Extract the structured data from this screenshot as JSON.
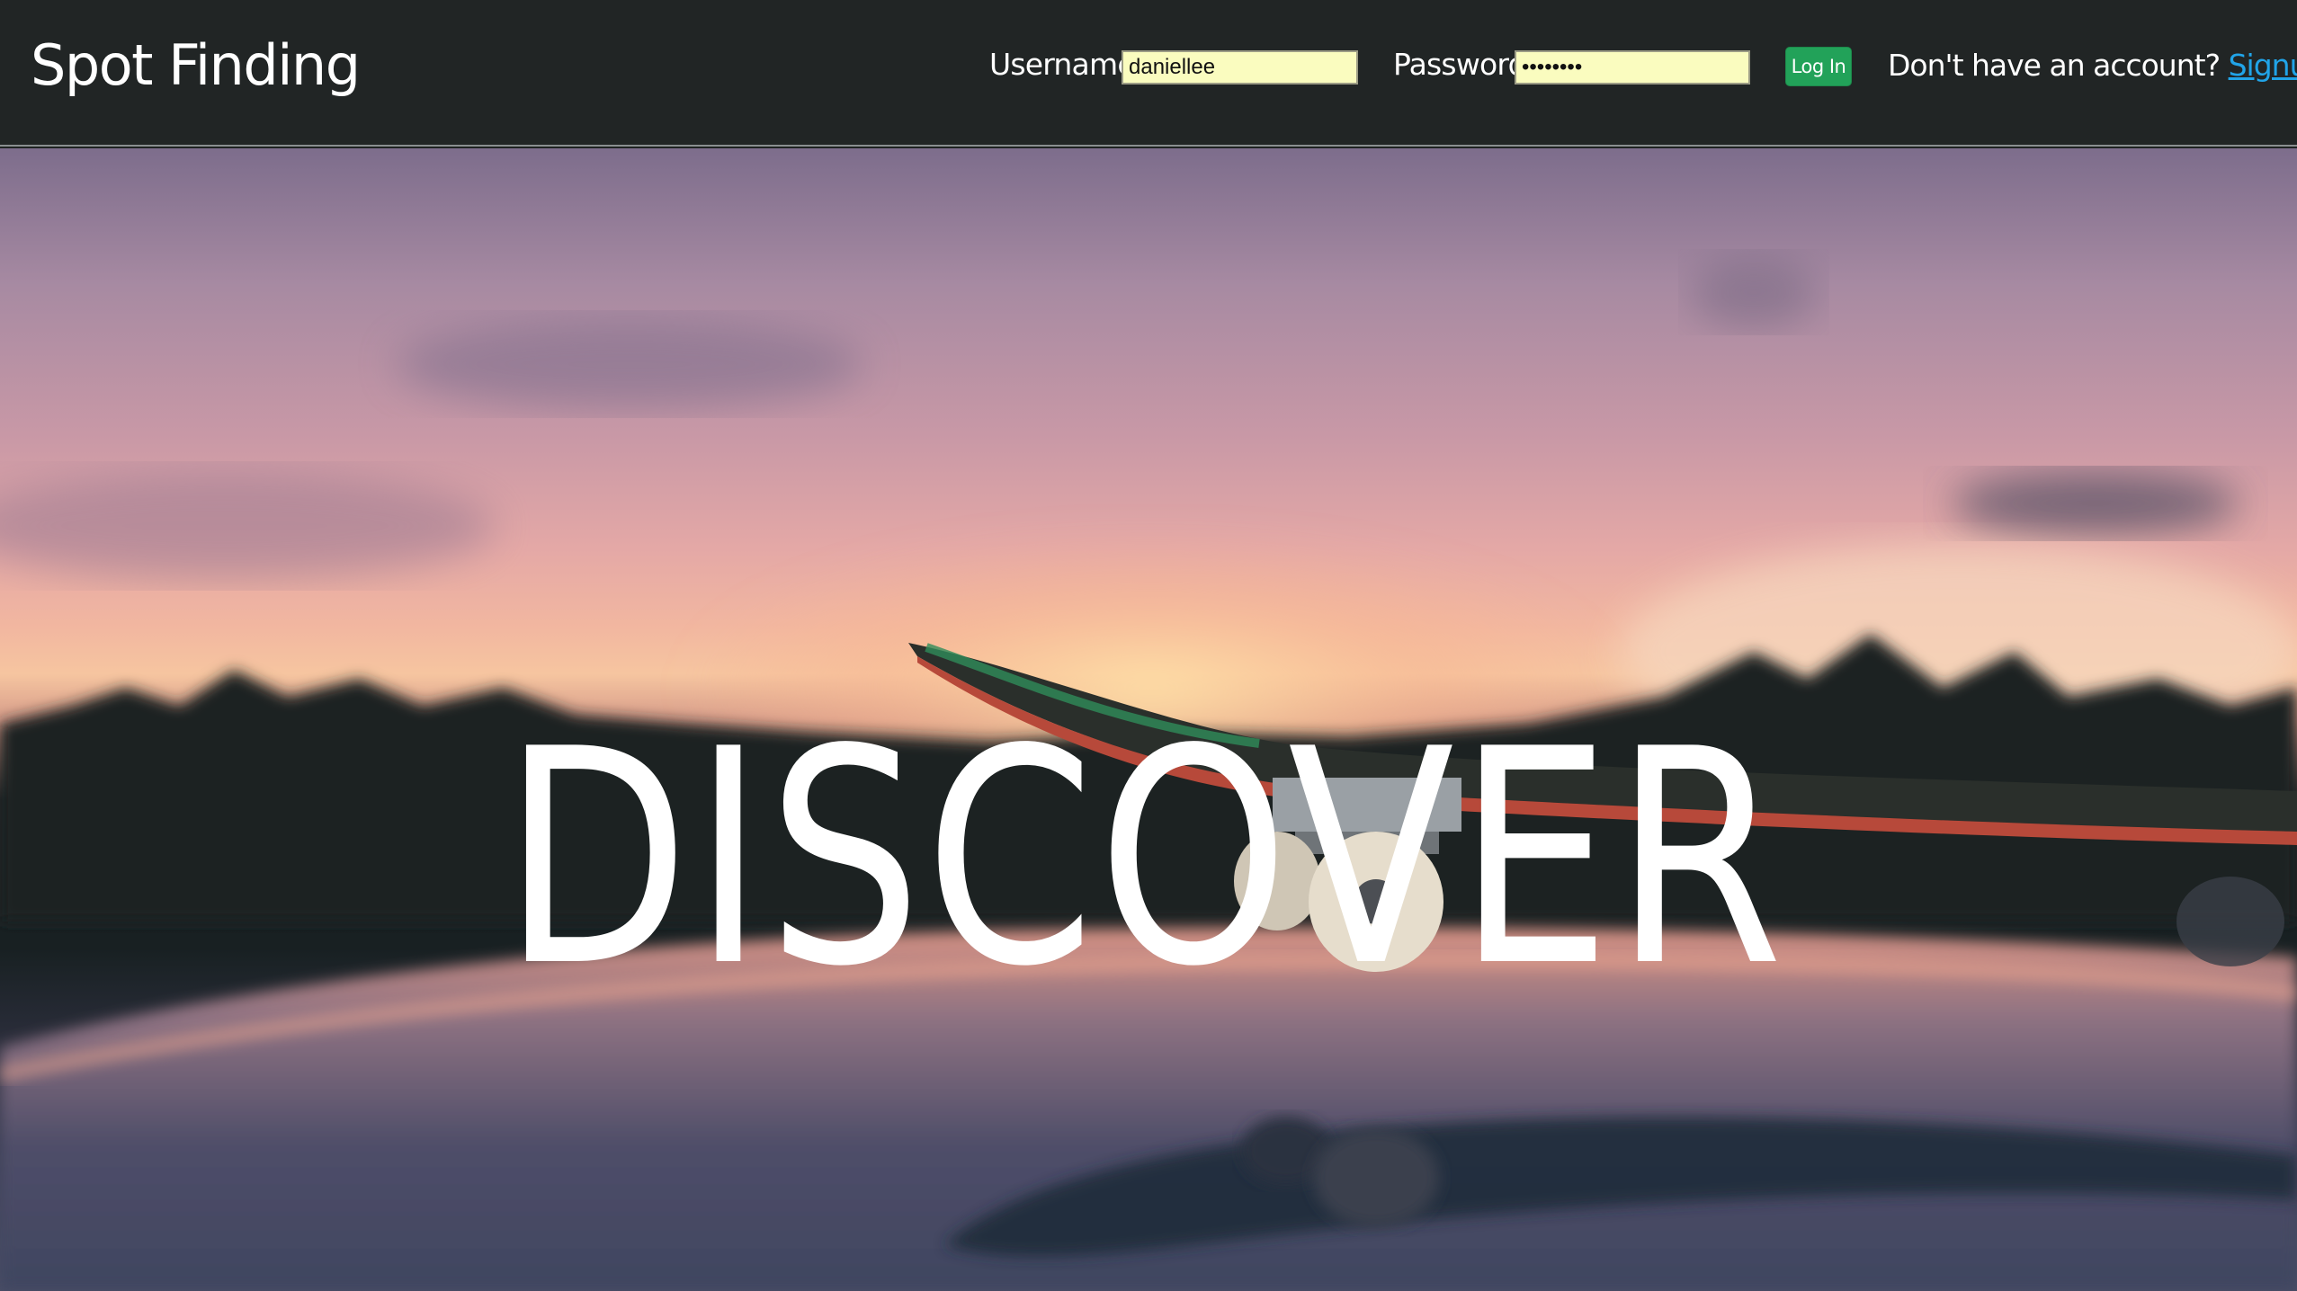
{
  "navbar": {
    "brand": "Spot Finding",
    "login": {
      "username_label": "Username",
      "username_value": "daniellee",
      "password_label": "Password",
      "password_value": "••••••••",
      "login_button": "Log In",
      "signup_prompt": "Don't have an account?",
      "signup_link": "Signup"
    }
  },
  "hero": {
    "title": "DISCOVER"
  },
  "colors": {
    "navbar_bg": "#212525",
    "input_bg": "#fafcbf",
    "login_button": "#22a259",
    "link": "#21a4e8"
  }
}
